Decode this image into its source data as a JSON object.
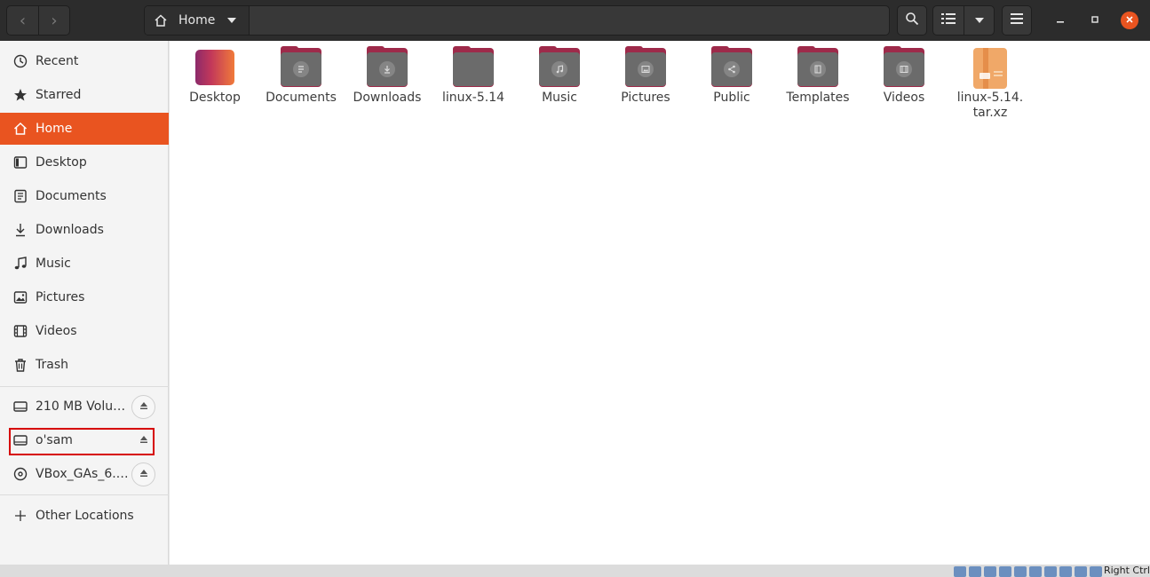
{
  "header": {
    "back_label": "‹",
    "forward_label": "›",
    "path_label": "Home"
  },
  "sidebar": {
    "places": [
      {
        "label": "Recent",
        "icon": "clock-icon"
      },
      {
        "label": "Starred",
        "icon": "star-icon"
      },
      {
        "label": "Home",
        "icon": "home-icon",
        "active": true
      },
      {
        "label": "Desktop",
        "icon": "desktop-icon"
      },
      {
        "label": "Documents",
        "icon": "document-icon"
      },
      {
        "label": "Downloads",
        "icon": "download-icon"
      },
      {
        "label": "Music",
        "icon": "music-icon"
      },
      {
        "label": "Pictures",
        "icon": "picture-icon"
      },
      {
        "label": "Videos",
        "icon": "video-icon"
      },
      {
        "label": "Trash",
        "icon": "trash-icon"
      }
    ],
    "devices": [
      {
        "label": "210 MB Volu…",
        "icon": "drive-icon"
      },
      {
        "label": "o'sam",
        "icon": "drive-icon"
      },
      {
        "label": "VBox_GAs_6.…",
        "icon": "disc-icon"
      }
    ],
    "other_locations": "Other Locations"
  },
  "files": [
    {
      "name": "Desktop",
      "kind": "desktop"
    },
    {
      "name": "Documents",
      "kind": "folder",
      "glyph": "document"
    },
    {
      "name": "Downloads",
      "kind": "folder",
      "glyph": "download"
    },
    {
      "name": "linux-5.14",
      "kind": "folder",
      "glyph": ""
    },
    {
      "name": "Music",
      "kind": "folder",
      "glyph": "music"
    },
    {
      "name": "Pictures",
      "kind": "folder",
      "glyph": "picture"
    },
    {
      "name": "Public",
      "kind": "folder",
      "glyph": "share"
    },
    {
      "name": "Templates",
      "kind": "folder",
      "glyph": "template"
    },
    {
      "name": "Videos",
      "kind": "folder",
      "glyph": "video"
    },
    {
      "name": "linux-5.14.\ntar.xz",
      "kind": "archive"
    }
  ],
  "statusbar": {
    "host_key": "Right Ctrl"
  },
  "colors": {
    "accent": "#e95420",
    "folder_tab": "#9e2a4a",
    "folder_body": "#6b6b6b",
    "highlight": "#d60000"
  }
}
